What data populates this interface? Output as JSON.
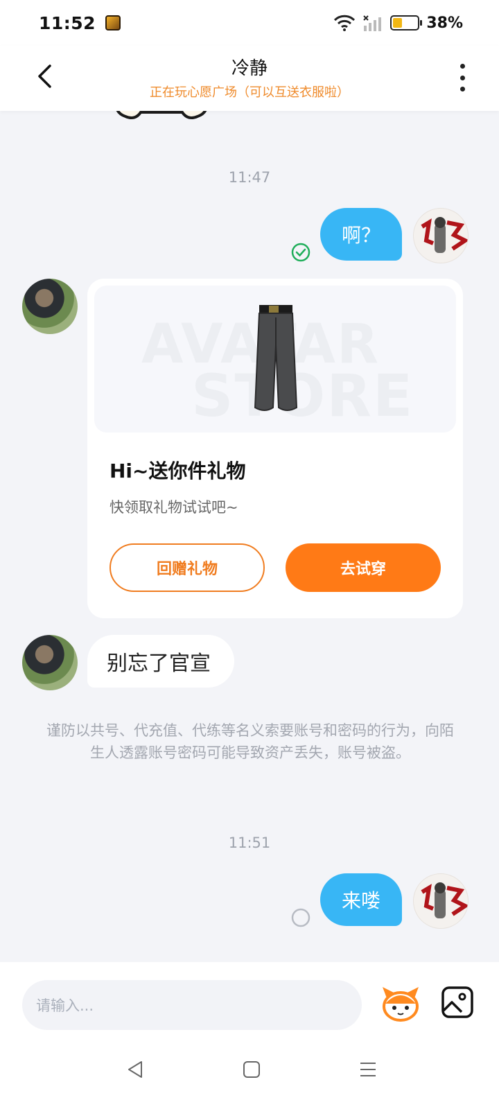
{
  "status_bar": {
    "time": "11:52",
    "battery_percent_text": "38%",
    "battery_level": 0.38
  },
  "header": {
    "title": "冷静",
    "subtitle": "正在玩心愿广场（可以互送衣服啦）"
  },
  "messages": {
    "time_1": "11:47",
    "sent_1": "啊？",
    "gift_card": {
      "watermark_line1": "AVATAR",
      "watermark_line2": "STORE",
      "title": "Hi~送你件礼物",
      "description": "快领取礼物试试吧~",
      "return_gift_label": "回赠礼物",
      "try_on_label": "去试穿"
    },
    "received_1": "别忘了官宣",
    "safety_notice": "谨防以共号、代充值、代练等名义索要账号和密码的行为，向陌生人透露账号密码可能导致资产丢失，账号被盗。",
    "time_2": "11:51",
    "sent_2": "来喽"
  },
  "input": {
    "placeholder": "请输入..."
  },
  "colors": {
    "accent_orange": "#ff7a16",
    "bubble_blue": "#38b6f5",
    "subtitle_orange": "#ef8a2a",
    "read_check_green": "#1fae5a"
  }
}
